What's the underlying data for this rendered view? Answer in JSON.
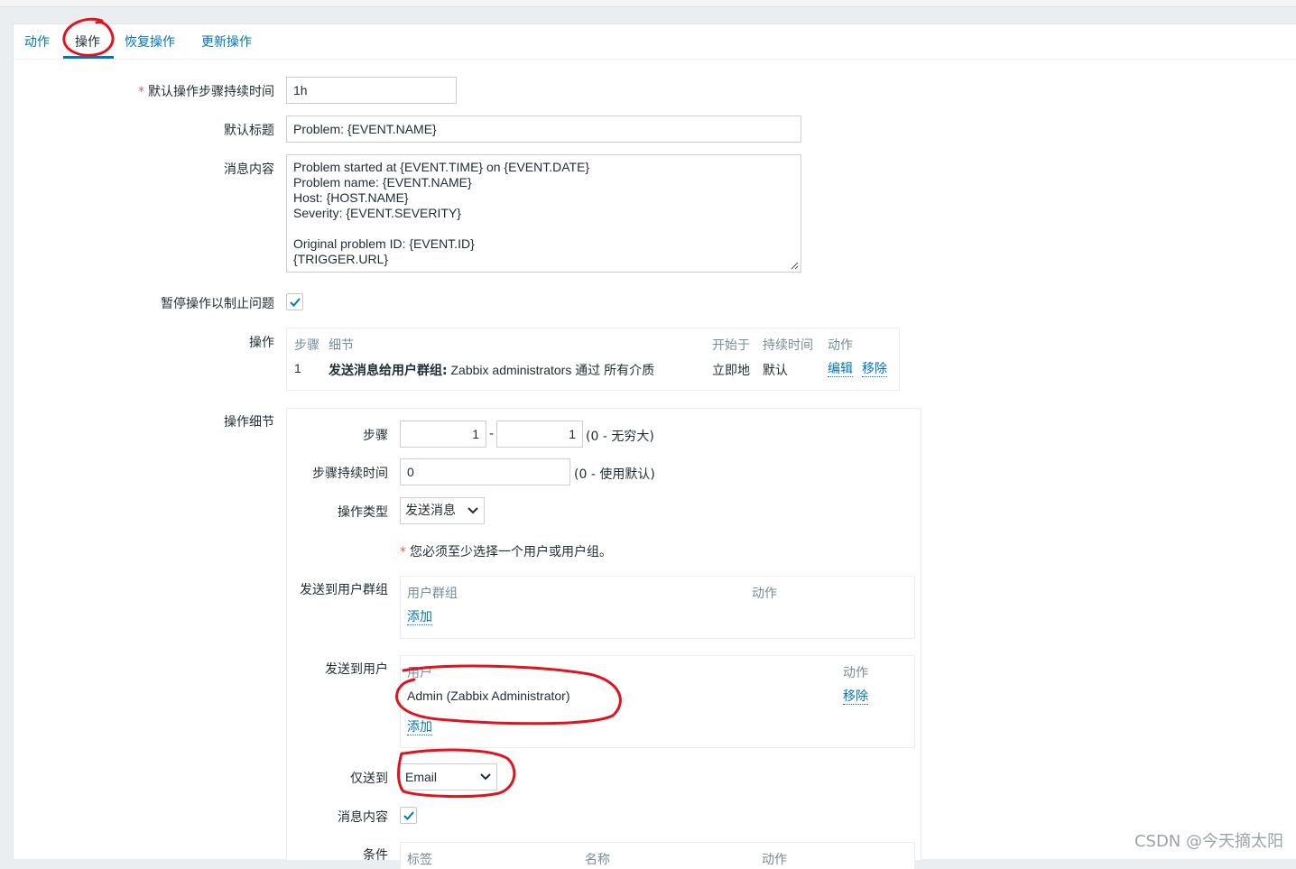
{
  "tabs": [
    {
      "label": "动作"
    },
    {
      "label": "操作"
    },
    {
      "label": "恢复操作"
    },
    {
      "label": "更新操作"
    }
  ],
  "form": {
    "default_step_duration": {
      "label": "默认操作步骤持续时间",
      "value": "1h"
    },
    "default_subject": {
      "label": "默认标题",
      "value": "Problem: {EVENT.NAME}"
    },
    "message": {
      "label": "消息内容",
      "lines": [
        "Problem started at {EVENT.TIME} on {EVENT.DATE}",
        "Problem name: {EVENT.NAME}",
        "Host: {HOST.NAME}",
        "Severity: {EVENT.SEVERITY}",
        "",
        "Original problem ID: {EVENT.ID}",
        "{TRIGGER.URL}"
      ]
    },
    "pause_suppressed": {
      "label": "暂停操作以制止问题",
      "checked": true
    },
    "operations": {
      "label": "操作",
      "headers": {
        "steps": "步骤",
        "details": "细节",
        "start_in": "开始于",
        "duration": "持续时间",
        "action": "动作"
      },
      "rows": [
        {
          "step": "1",
          "detail_bold": "发送消息给用户群组:",
          "detail_rest": "Zabbix administrators 通过 所有介质",
          "start_in": "立即地",
          "duration": "默认",
          "edit": "编辑",
          "remove": "移除"
        }
      ]
    },
    "operation_details": {
      "label": "操作细节",
      "steps": {
        "label": "步骤",
        "from": "1",
        "to": "1",
        "sep": "-",
        "hint": "(0 - 无穷大)"
      },
      "step_duration": {
        "label": "步骤持续时间",
        "value": "0",
        "hint": "(0 - 使用默认)"
      },
      "operation_type": {
        "label": "操作类型",
        "value": "发送消息"
      },
      "requirement": "您必须至少选择一个用户或用户组。",
      "send_to_groups": {
        "label": "发送到用户群组",
        "col_group": "用户群组",
        "col_action": "动作",
        "add": "添加"
      },
      "send_to_users": {
        "label": "发送到用户",
        "col_user": "用户",
        "col_action": "动作",
        "rows": [
          {
            "name": "Admin (Zabbix Administrator)",
            "remove": "移除"
          }
        ],
        "add": "添加"
      },
      "send_only_to": {
        "label": "仅送到",
        "value": "Email"
      },
      "custom_message": {
        "label": "消息内容",
        "checked": true
      },
      "conditions": {
        "label": "条件",
        "col_label": "标签",
        "col_name": "名称",
        "col_action": "动作"
      }
    }
  },
  "watermark": "CSDN @今天摘太阳",
  "colors": {
    "link": "#0275b8",
    "annotation": "#e0141e",
    "required": "#e45959"
  }
}
